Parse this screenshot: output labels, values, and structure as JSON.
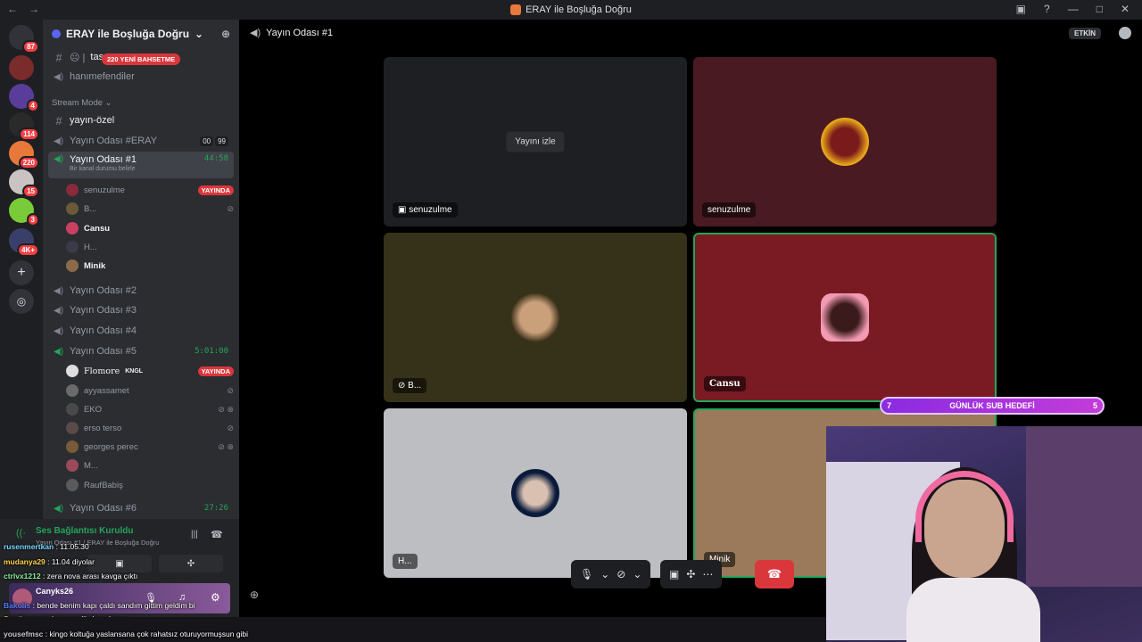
{
  "window": {
    "title": "ERAY ile Boşluğa Doğru"
  },
  "rail": {
    "badges": [
      "87",
      "4",
      "114",
      "220",
      "15",
      "3",
      "4K+"
    ]
  },
  "sidebar": {
    "guild_name": "ERAY ile Boşluğa Doğru",
    "top_channel": "tas",
    "top_pill": "220 YENİ BAHSETME",
    "hanimefendiler": "hanımefendiler",
    "category": "Stream Mode",
    "yayin_ozel": "yayın-özel",
    "room_eray": "Yayın Odası #ERAY",
    "room_eray_counts": [
      "00",
      "99"
    ],
    "room1": {
      "label": "Yayın Odası #1",
      "timer": "44:58",
      "status": "Bir kanal durumu belirle"
    },
    "room1_users": [
      {
        "name": "senuzulme",
        "live": "YAYINDA"
      },
      {
        "name": "B..."
      },
      {
        "name": "Cansu"
      },
      {
        "name": "H..."
      },
      {
        "name": "Minik"
      }
    ],
    "room2": "Yayın Odası #2",
    "room3": "Yayın Odası #3",
    "room4": "Yayın Odası #4",
    "room5": {
      "label": "Yayın Odası #5",
      "timer": "5:01:00"
    },
    "room5_users": [
      {
        "name": "Flomore",
        "tag": "KNGL",
        "live": "YAYINDA"
      },
      {
        "name": "ayyassamet"
      },
      {
        "name": "EKO"
      },
      {
        "name": "erso terso"
      },
      {
        "name": "georges perec"
      },
      {
        "name": "M..."
      },
      {
        "name": "RaufBabiş"
      }
    ],
    "room6": {
      "label": "Yayın Odası #6",
      "timer": "27:26"
    }
  },
  "voice_panel": {
    "status": "Ses Bağlantısı Kuruldu",
    "sub": "Yayın Odası #1 / ERAY ile Boşluğa Doğru",
    "user": "Canyks26"
  },
  "chat": [
    {
      "name": "rusenmertkan",
      "text": " : 11.05.30"
    },
    {
      "name": "mudanya29",
      "text": " : 11.04 diyolar"
    },
    {
      "name": "ctrlvx1212",
      "text": " : zera nova arası kavga çıktı"
    },
    {
      "name": "Bakolis",
      "text": " : bende benim kapı çaldı sandım gittim geldim bi"
    },
    {
      "name": "Santiagomunies",
      "text": " : mediis kanalını ac"
    },
    {
      "name": "yousefmsc",
      "text": " : kingo koltuğa yaslansana çok rahatsız oturuyormuşsun gibi"
    }
  ],
  "main": {
    "channel": "Yayın Odası #1",
    "activity": "ETKİN",
    "watch": "Yayını izle",
    "tiles": [
      {
        "label": "senuzulme"
      },
      {
        "label": "senuzulme"
      },
      {
        "label": "B..."
      },
      {
        "label": "Cansu"
      },
      {
        "label": "H..."
      },
      {
        "label": "Minik"
      }
    ]
  },
  "overlay": {
    "sub_goal": {
      "current": "7",
      "label": "GÜNLÜK SUB HEDEFİ",
      "target": "5"
    }
  },
  "colors": {
    "live": "#da373c",
    "connected": "#23a55a",
    "accent": "#5865f2"
  }
}
